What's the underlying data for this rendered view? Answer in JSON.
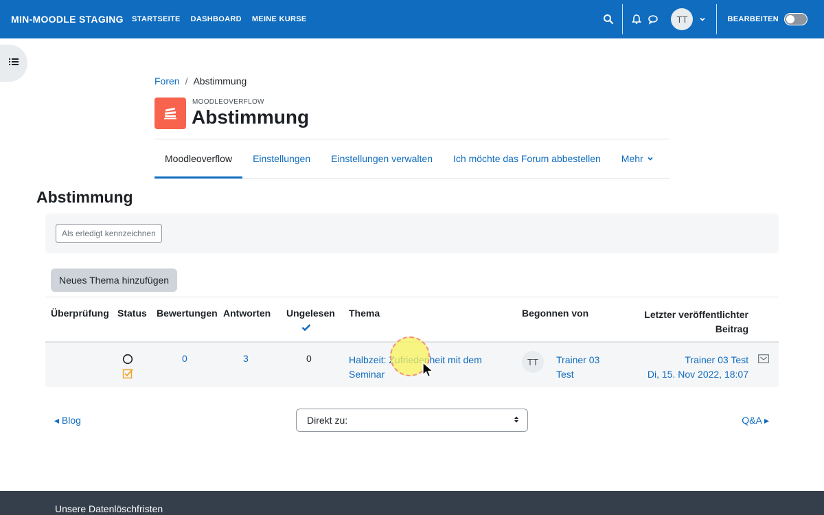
{
  "navbar": {
    "brand": "MIN-MOODLE STAGING",
    "links": [
      "STARTSEITE",
      "DASHBOARD",
      "MEINE KURSE"
    ],
    "user_initials": "TT",
    "edit_mode_label": "BEARBEITEN",
    "edit_mode_on": false,
    "color": "#0f6cbf"
  },
  "breadcrumb": {
    "items": [
      "Foren",
      "Abstimmung"
    ],
    "separator": "/"
  },
  "header": {
    "module_type": "MOODLEOVERFLOW",
    "title": "Abstimmung",
    "icon_color": "#f7634d"
  },
  "secondary_nav": {
    "tabs": [
      "Moodleoverflow",
      "Einstellungen",
      "Einstellungen verwalten",
      "Ich möchte das Forum abbestellen",
      "Mehr"
    ],
    "active_index": 0
  },
  "main": {
    "section_title": "Abstimmung",
    "mark_done_label": "Als erledigt kennzeichnen",
    "add_topic_label": "Neues Thema hinzufügen"
  },
  "table": {
    "headers": {
      "review": "Überprüfung",
      "status": "Status",
      "ratings": "Bewertungen",
      "replies": "Antworten",
      "unread": "Ungelesen",
      "topic": "Thema",
      "started_by": "Begonnen von",
      "last_post_line1": "Letzter veröffentlichter",
      "last_post_line2": "Beitrag"
    },
    "rows": [
      {
        "ratings": "0",
        "replies": "3",
        "unread": "0",
        "topic_line1": "Halbzeit: Zufriedenheit mit dem",
        "topic_line2": "Seminar",
        "author_initials": "TT",
        "author_line1": "Trainer 03",
        "author_line2": "Test",
        "last_post_author": "Trainer 03 Test",
        "last_post_date": "Di, 15. Nov 2022, 18:07"
      }
    ]
  },
  "bottom_nav": {
    "prev": "◂ Blog",
    "jump_placeholder": "Direkt zu:",
    "next": "Q&A ▸"
  },
  "footer": {
    "text": "Unsere Datenlöschfristen"
  }
}
